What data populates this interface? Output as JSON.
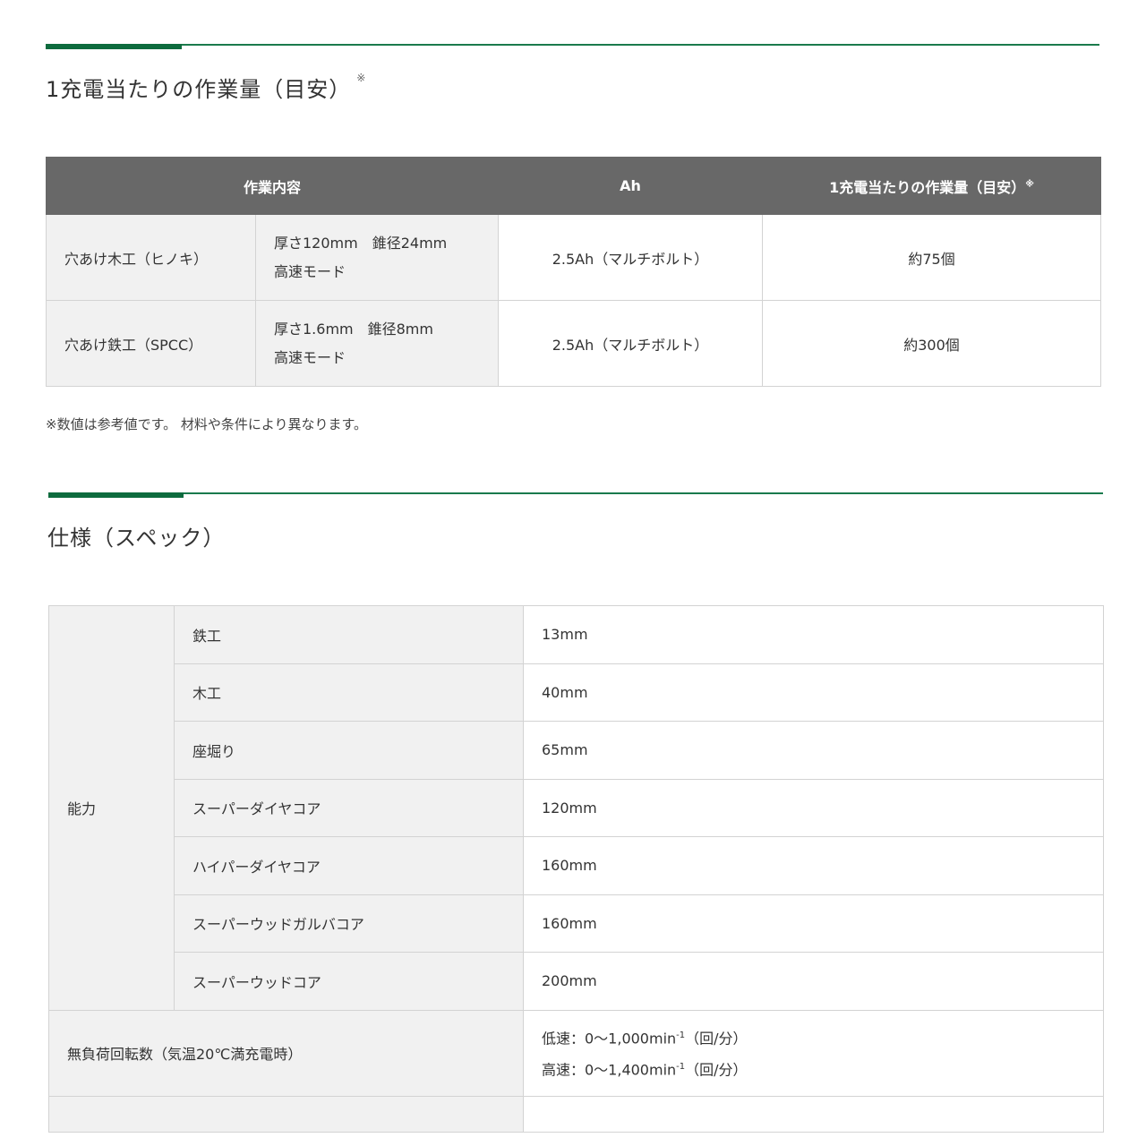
{
  "section1": {
    "title": "1充電当たりの作業量（目安）",
    "title_mark": "※",
    "headers": [
      "作業内容",
      "Ah",
      "1充電当たりの作業量（目安）"
    ],
    "header_mark": "※",
    "rows": [
      {
        "task": "穴あけ木工（ヒノキ）",
        "cond1": "厚さ120mm　錐径24mm",
        "cond2": "高速モード",
        "ah": "2.5Ah（マルチボルト）",
        "amount": "約75個"
      },
      {
        "task": "穴あけ鉄工（SPCC）",
        "cond1": "厚さ1.6mm　錐径8mm",
        "cond2": "高速モード",
        "ah": "2.5Ah（マルチボルト）",
        "amount": "約300個"
      }
    ],
    "note": "※数値は参考値です。 材料や条件により異なります。"
  },
  "section2": {
    "title": "仕様（スペック）",
    "capacity_label": "能力",
    "capacity": [
      {
        "item": "鉄工",
        "value": "13mm"
      },
      {
        "item": "木工",
        "value": "40mm"
      },
      {
        "item": "座堀り",
        "value": "65mm"
      },
      {
        "item": "スーパーダイヤコア",
        "value": "120mm"
      },
      {
        "item": "ハイパーダイヤコア",
        "value": "160mm"
      },
      {
        "item": "スーパーウッドガルバコア",
        "value": "160mm"
      },
      {
        "item": "スーパーウッドコア",
        "value": "200mm"
      }
    ],
    "speed_label": "無負荷回転数（気温20℃満充電時）",
    "speed_low": "低速：0～1,000min",
    "speed_high": "高速：0～1,400min",
    "speed_exp": "-1",
    "speed_unit": "（回/分）"
  },
  "colors": {
    "accent": "#0e6b3e",
    "header_bg": "#686868",
    "cell_bg": "#f1f1f1"
  }
}
